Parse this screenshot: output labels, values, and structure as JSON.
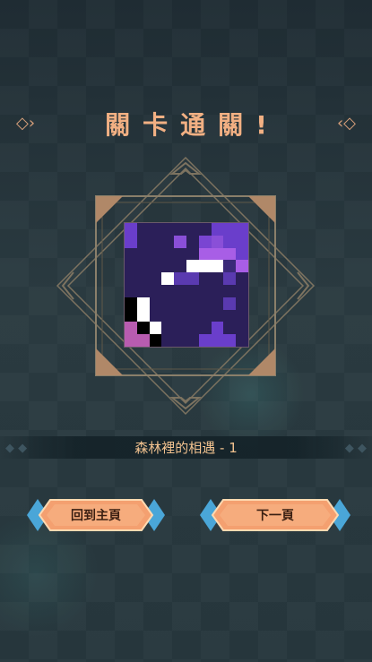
{
  "title": "關卡通關!",
  "level_name": "森林裡的相遇 - 1",
  "buttons": {
    "home": "回到主頁",
    "next": "下一頁"
  },
  "icons": {
    "title_left": "arrow-diamond-right-icon",
    "title_right": "arrow-diamond-left-icon"
  },
  "colors": {
    "title": "#f2b083",
    "level_text": "#f1c28f",
    "button_fill": "#f4a070",
    "button_edge": "#4aa6d8"
  },
  "puzzle": {
    "rows": 10,
    "cols": 10,
    "cells": [
      [
        "#6a3ecb",
        "#2b1f59",
        "#2b1f59",
        "#2b1f59",
        "#2b1f59",
        "#2b1f59",
        "#2b1f59",
        "#6a3ecb",
        "#6a3ecb",
        "#6a3ecb"
      ],
      [
        "#6a3ecb",
        "#2b1f59",
        "#2b1f59",
        "#2b1f59",
        "#8a4fd8",
        "#2b1f59",
        "#7a45d2",
        "#8a4fd8",
        "#6a3ecb",
        "#6a3ecb"
      ],
      [
        "#2b1f59",
        "#2b1f59",
        "#2b1f59",
        "#2b1f59",
        "#2b1f59",
        "#2b1f59",
        "#a85ee6",
        "#a85ee6",
        "#a85ee6",
        "#6a3ecb"
      ],
      [
        "#2b1f59",
        "#2b1f59",
        "#2b1f59",
        "#2b1f59",
        "#2b1f59",
        "#ffffff",
        "#ffffff",
        "#ffffff",
        "#3a2a78",
        "#a85ee6"
      ],
      [
        "#2b1f59",
        "#2b1f59",
        "#2b1f59",
        "#ffffff",
        "#5a3ab0",
        "#5a3ab0",
        "#2b1f59",
        "#2b1f59",
        "#5a3ab0",
        "#2b1f59"
      ],
      [
        "#2b1f59",
        "#2b1f59",
        "#2b1f59",
        "#2b1f59",
        "#2b1f59",
        "#2b1f59",
        "#2b1f59",
        "#2b1f59",
        "#2b1f59",
        "#2b1f59"
      ],
      [
        "#000000",
        "#ffffff",
        "#2b1f59",
        "#2b1f59",
        "#2b1f59",
        "#2b1f59",
        "#2b1f59",
        "#2b1f59",
        "#5a3ab0",
        "#2b1f59"
      ],
      [
        "#000000",
        "#ffffff",
        "#2b1f59",
        "#2b1f59",
        "#2b1f59",
        "#2b1f59",
        "#2b1f59",
        "#2b1f59",
        "#2b1f59",
        "#2b1f59"
      ],
      [
        "#b85cb0",
        "#000000",
        "#ffffff",
        "#2b1f59",
        "#2b1f59",
        "#2b1f59",
        "#2b1f59",
        "#6a3ecb",
        "#2b1f59",
        "#2b1f59"
      ],
      [
        "#b85cb0",
        "#b85cb0",
        "#000000",
        "#2b1f59",
        "#2b1f59",
        "#2b1f59",
        "#6a3ecb",
        "#6a3ecb",
        "#6a3ecb",
        "#2b1f59"
      ]
    ]
  }
}
